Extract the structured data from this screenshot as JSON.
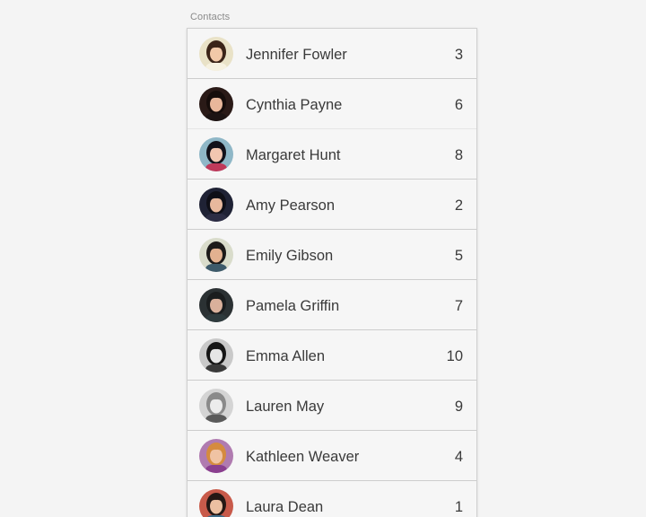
{
  "section": {
    "title": "Contacts"
  },
  "contacts": [
    {
      "name": "Jennifer Fowler",
      "count": "3",
      "avatar": {
        "bg": "#e9e2c7",
        "skin": "#f1c9a8",
        "hair": "#3b2418",
        "top": "#f6f1e0"
      }
    },
    {
      "name": "Cynthia Payne",
      "count": "6",
      "avatar": {
        "bg": "#2a1a17",
        "skin": "#e8b79b",
        "hair": "#160d0b",
        "top": "#1d1413"
      }
    },
    {
      "name": "Margaret Hunt",
      "count": "8",
      "avatar": {
        "bg": "#8fb7c7",
        "skin": "#f2c6b0",
        "hair": "#12111a",
        "top": "#c0395a"
      }
    },
    {
      "name": "Amy Pearson",
      "count": "2",
      "avatar": {
        "bg": "#1f2235",
        "skin": "#e7b89d",
        "hair": "#0f0f17",
        "top": "#2c2d44"
      }
    },
    {
      "name": "Emily Gibson",
      "count": "5",
      "avatar": {
        "bg": "#d9dccb",
        "skin": "#e2b190",
        "hair": "#1c1a19",
        "top": "#3d5a6a"
      }
    },
    {
      "name": "Pamela Griffin",
      "count": "7",
      "avatar": {
        "bg": "#2b3133",
        "skin": "#d9b09b",
        "hair": "#1a1d1e",
        "top": "#2e3a3d"
      }
    },
    {
      "name": "Emma Allen",
      "count": "10",
      "avatar": {
        "bg": "#c9c9c9",
        "skin": "#e6e6e6",
        "hair": "#161616",
        "top": "#3a3a3a"
      }
    },
    {
      "name": "Lauren May",
      "count": "9",
      "avatar": {
        "bg": "#d4d4d4",
        "skin": "#ececec",
        "hair": "#8a8a8a",
        "top": "#5a5a5a"
      }
    },
    {
      "name": "Kathleen Weaver",
      "count": "4",
      "avatar": {
        "bg": "#b07bb0",
        "skin": "#f0c3a3",
        "hair": "#d58b3f",
        "top": "#8a3f8f"
      }
    },
    {
      "name": "Laura Dean",
      "count": "1",
      "avatar": {
        "bg": "#c85a4a",
        "skin": "#ecc0a2",
        "hair": "#251815",
        "top": "#3f6d8a"
      }
    }
  ]
}
